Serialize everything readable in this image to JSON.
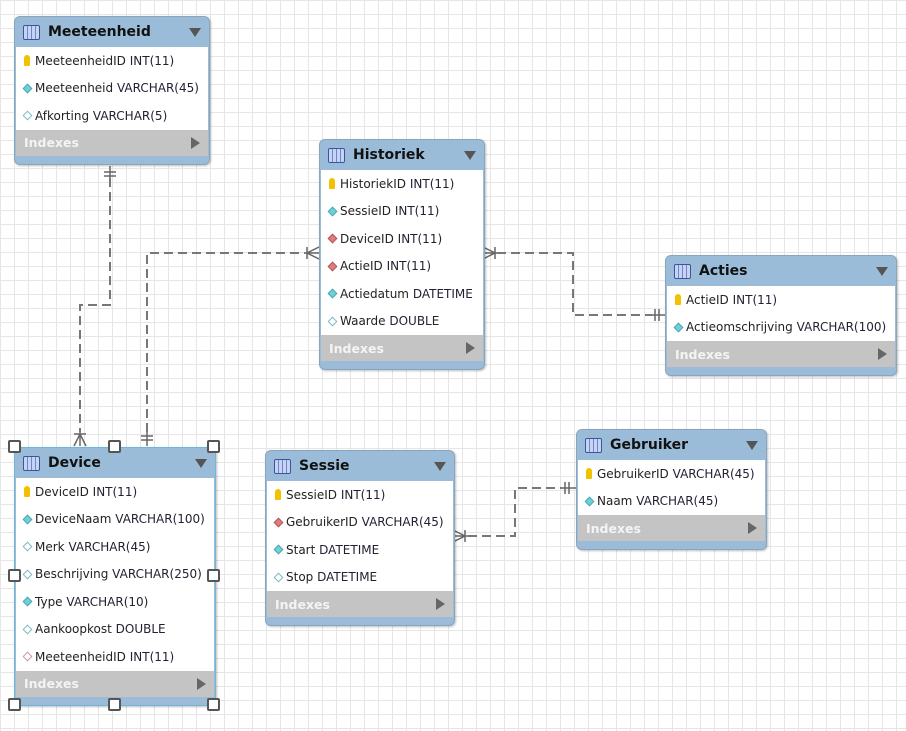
{
  "tables": {
    "meeteenheid": {
      "name": "Meeteenheid",
      "indexes": "Indexes",
      "columns": [
        {
          "name": "MeeteenheidID",
          "type": "INT(11)",
          "icon": "key"
        },
        {
          "name": "Meeteenheid",
          "type": "VARCHAR(45)",
          "icon": "nn"
        },
        {
          "name": "Afkorting",
          "type": "VARCHAR(5)",
          "icon": "nl"
        }
      ]
    },
    "historiek": {
      "name": "Historiek",
      "indexes": "Indexes",
      "columns": [
        {
          "name": "HistoriekID",
          "type": "INT(11)",
          "icon": "key"
        },
        {
          "name": "SessieID",
          "type": "INT(11)",
          "icon": "nn"
        },
        {
          "name": "DeviceID",
          "type": "INT(11)",
          "icon": "fk"
        },
        {
          "name": "ActieID",
          "type": "INT(11)",
          "icon": "fk"
        },
        {
          "name": "Actiedatum",
          "type": "DATETIME",
          "icon": "nn"
        },
        {
          "name": "Waarde",
          "type": "DOUBLE",
          "icon": "nl"
        }
      ]
    },
    "acties": {
      "name": "Acties",
      "indexes": "Indexes",
      "columns": [
        {
          "name": "ActieID",
          "type": "INT(11)",
          "icon": "key"
        },
        {
          "name": "Actieomschrijving",
          "type": "VARCHAR(100)",
          "icon": "nn"
        }
      ]
    },
    "device": {
      "name": "Device",
      "indexes": "Indexes",
      "columns": [
        {
          "name": "DeviceID",
          "type": "INT(11)",
          "icon": "key"
        },
        {
          "name": "DeviceNaam",
          "type": "VARCHAR(100)",
          "icon": "nn"
        },
        {
          "name": "Merk",
          "type": "VARCHAR(45)",
          "icon": "nl"
        },
        {
          "name": "Beschrijving",
          "type": "VARCHAR(250)",
          "icon": "nl"
        },
        {
          "name": "Type",
          "type": "VARCHAR(10)",
          "icon": "nn"
        },
        {
          "name": "Aankoopkost",
          "type": "DOUBLE",
          "icon": "nl"
        },
        {
          "name": "MeeteenheidID",
          "type": "INT(11)",
          "icon": "fkn"
        }
      ]
    },
    "sessie": {
      "name": "Sessie",
      "indexes": "Indexes",
      "columns": [
        {
          "name": "SessieID",
          "type": "INT(11)",
          "icon": "key"
        },
        {
          "name": "GebruikerID",
          "type": "VARCHAR(45)",
          "icon": "fk"
        },
        {
          "name": "Start",
          "type": "DATETIME",
          "icon": "nn"
        },
        {
          "name": "Stop",
          "type": "DATETIME",
          "icon": "nl"
        }
      ]
    },
    "gebruiker": {
      "name": "Gebruiker",
      "indexes": "Indexes",
      "columns": [
        {
          "name": "GebruikerID",
          "type": "VARCHAR(45)",
          "icon": "key"
        },
        {
          "name": "Naam",
          "type": "VARCHAR(45)",
          "icon": "nn"
        }
      ]
    }
  },
  "selected_table": "device",
  "colors": {
    "header": "#9bbcd8",
    "line": "#777777",
    "indexes": "#c4c4c4"
  }
}
